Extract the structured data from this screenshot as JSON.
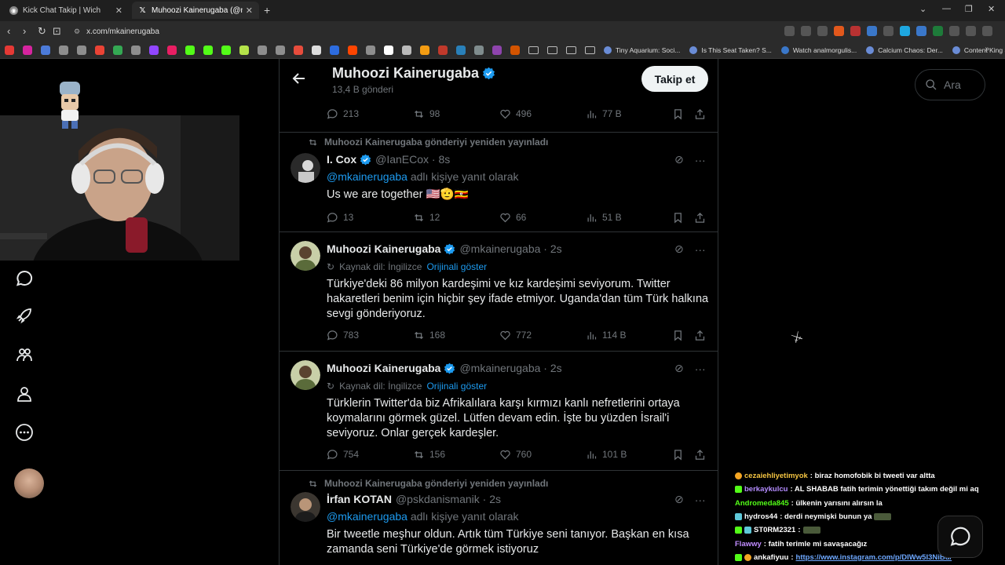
{
  "browser": {
    "tabs": [
      {
        "title": "Kick Chat Takip | Wich",
        "favicon": "kick-icon"
      },
      {
        "title": "Muhoozi Kainerugaba (@mkainerugaba) / X",
        "favicon": "x-logo-icon"
      }
    ],
    "url": "x.com/mkainerugaba",
    "bookmarks": [
      "Tiny Aquarium: Soci...",
      "Is This Seat Taken? S...",
      "Watch analmorgulis...",
      "Calcium Chaos: Der...",
      "Content King Steam..."
    ]
  },
  "header": {
    "name": "Muhoozi Kainerugaba",
    "post_count": "13,4 B gönderi",
    "follow_label": "Takip et"
  },
  "search": {
    "placeholder": "Ara"
  },
  "colors": {
    "accent": "#1d9bf0",
    "background": "#000000",
    "muted": "#71767b"
  },
  "top_stats": {
    "replies": "213",
    "retweets": "98",
    "likes": "496",
    "views": "77 B"
  },
  "tweets": [
    {
      "retweet_note": "Muhoozi Kainerugaba gönderiyi yeniden yayınladı",
      "name": "I. Cox",
      "handle": "@IanECox · 8s",
      "reply_mention": "@mkainerugaba",
      "reply_suffix": " adlı kişiye yanıt olarak",
      "text": "Us we are together 🇺🇸🫡🇺🇬",
      "stats": {
        "replies": "13",
        "retweets": "12",
        "likes": "66",
        "views": "51 B"
      }
    },
    {
      "name": "Muhoozi Kainerugaba",
      "handle": "@mkainerugaba · 2s",
      "source_lang": "Kaynak dil: İngilizce",
      "show_original": "Orijinali göster",
      "text": "Türkiye'deki 86 milyon kardeşimi ve kız kardeşimi seviyorum. Twitter hakaretleri benim için hiçbir şey ifade etmiyor. Uganda'dan tüm Türk halkına sevgi gönderiyoruz.",
      "stats": {
        "replies": "783",
        "retweets": "168",
        "likes": "772",
        "views": "114 B"
      }
    },
    {
      "name": "Muhoozi Kainerugaba",
      "handle": "@mkainerugaba · 2s",
      "source_lang": "Kaynak dil: İngilizce",
      "show_original": "Orijinali göster",
      "text": "Türklerin Twitter'da biz Afrikalılara karşı kırmızı kanlı nefretlerini ortaya koymalarını görmek güzel. Lütfen devam edin. İşte bu yüzden İsrail'i seviyoruz. Onlar gerçek kardeşler.",
      "stats": {
        "replies": "754",
        "retweets": "156",
        "likes": "760",
        "views": "101 B"
      }
    },
    {
      "retweet_note": "Muhoozi Kainerugaba gönderiyi yeniden yayınladı",
      "name": "İrfan KOTAN",
      "handle": "@pskdanismanik · 2s",
      "reply_mention": "@mkainerugaba",
      "reply_suffix": " adlı kişiye yanıt olarak",
      "text": "Bir tweetle meşhur oldun. Artık tüm Türkiye seni tanıyor. Başkan en kısa zamanda seni Türkiye'de görmek istiyoruz"
    }
  ],
  "chat": [
    {
      "user": "cezaiehliyetimyok",
      "message": ": biraz homofobik bi tweeti var altta",
      "color": "#f5c542"
    },
    {
      "user": "berkaykulcu",
      "message": ": AL SHABAB fatih terimin yönettiği takım değil mi aq",
      "color": "#b48cff"
    },
    {
      "user": "Andromeda845",
      "message": ": ülkenin yarısını alırsın la",
      "color": "#53fc18"
    },
    {
      "user": "hydros44",
      "message": ": derdi neymişki bunun ya",
      "color": "#ffffff"
    },
    {
      "user": "ST0RM2321",
      "message": ":",
      "color": "#ffffff"
    },
    {
      "user": "Flawwy",
      "message": ": fatih terimle mi savaşacağız",
      "color": "#c08cff"
    },
    {
      "user": "ankafiyuu",
      "message": ": ",
      "link": "https://www.instagram.com/p/DIWw5I3NiBu/",
      "color": "#ffffff"
    }
  ]
}
